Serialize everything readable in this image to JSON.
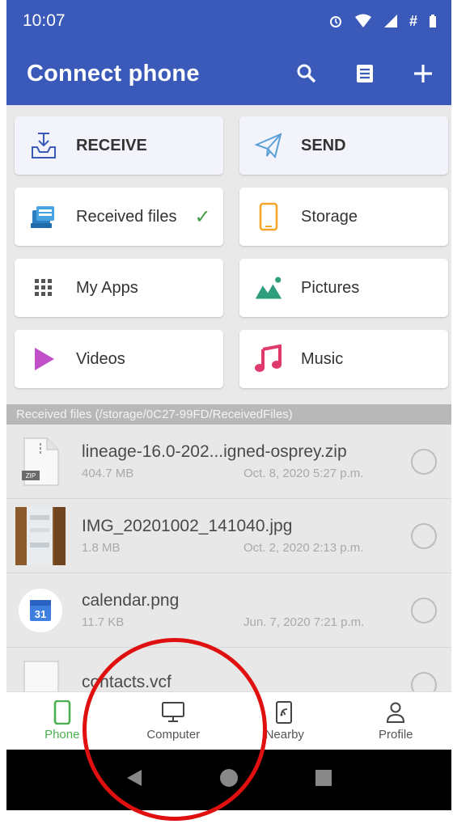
{
  "status_bar": {
    "time": "10:07"
  },
  "app_bar": {
    "title": "Connect phone"
  },
  "grid": {
    "receive": "RECEIVE",
    "send": "SEND",
    "received_files": "Received files",
    "storage": "Storage",
    "my_apps": "My Apps",
    "pictures": "Pictures",
    "videos": "Videos",
    "music": "Music"
  },
  "section_header": "Received files (/storage/0C27-99FD/ReceivedFiles)",
  "files": [
    {
      "name": "lineage-16.0-202...igned-osprey.zip",
      "size": "404.7 MB",
      "date": "Oct. 8, 2020 5:27 p.m."
    },
    {
      "name": "IMG_20201002_141040.jpg",
      "size": "1.8 MB",
      "date": "Oct. 2, 2020 2:13 p.m."
    },
    {
      "name": "calendar.png",
      "size": "11.7 KB",
      "date": "Jun. 7, 2020 7:21 p.m."
    },
    {
      "name": "contacts.vcf",
      "size": "",
      "date": ""
    }
  ],
  "calendar_icon_day": "31",
  "zip_icon_label": "ZIP",
  "bottom_nav": {
    "phone": "Phone",
    "computer": "Computer",
    "nearby": "Nearby",
    "profile": "Profile"
  },
  "colors": {
    "primary": "#3a59b9",
    "active_tab": "#4caf50",
    "annotation": "#e01010"
  }
}
